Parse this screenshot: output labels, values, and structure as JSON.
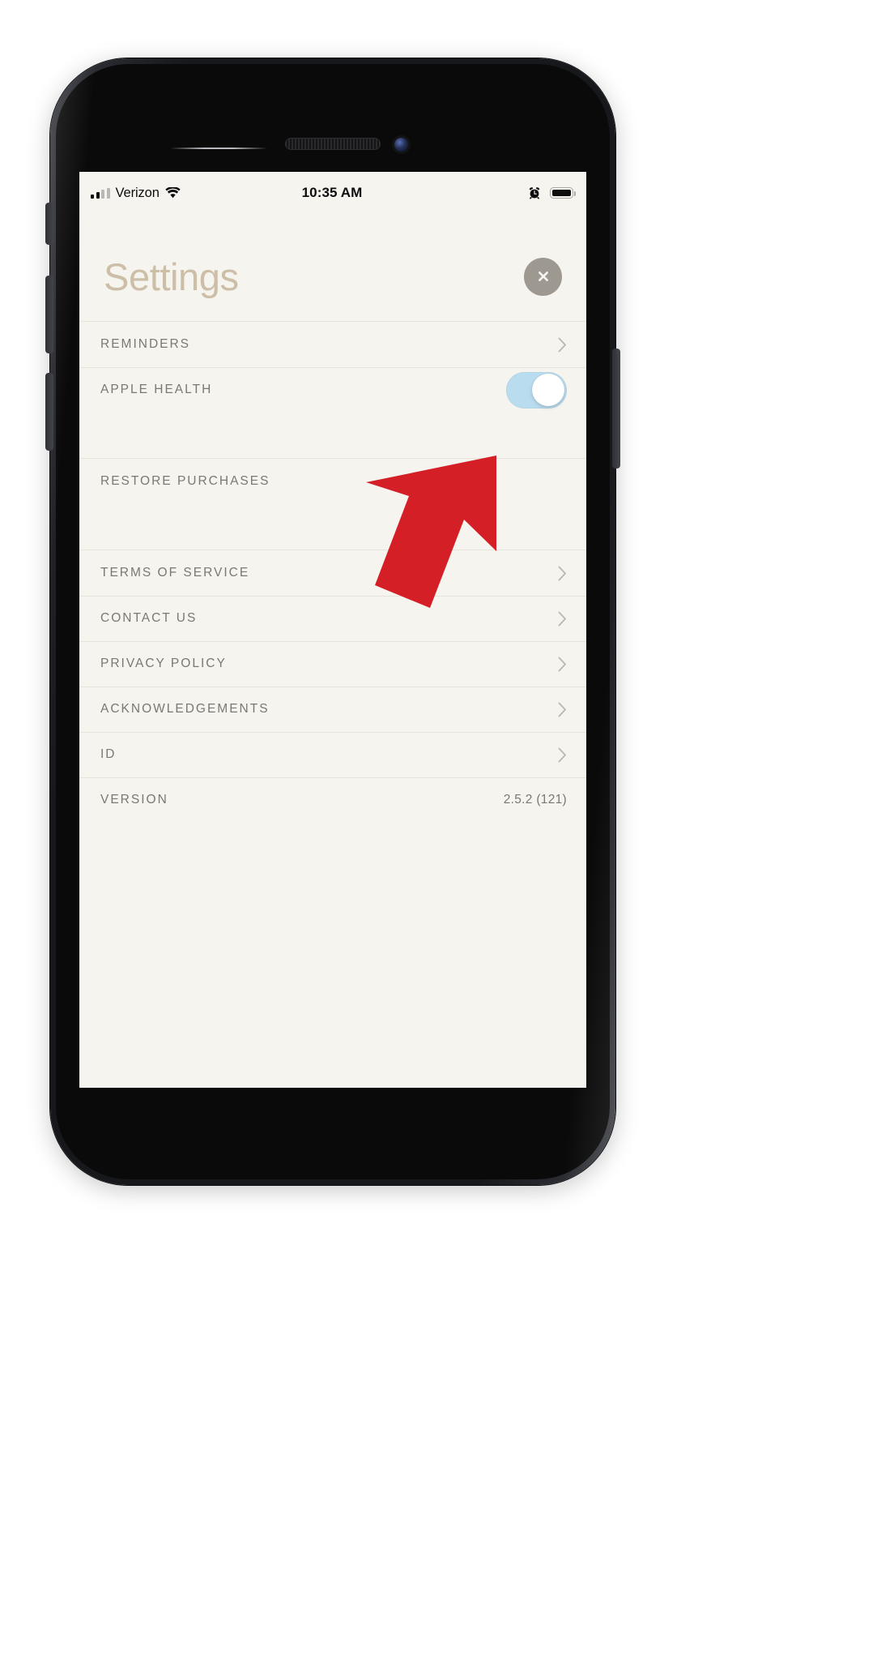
{
  "device": {
    "name": "iphone",
    "frame_color": "#1a1b1f"
  },
  "status_bar": {
    "carrier": "Verizon",
    "signal_icon": "signal-bars-icon",
    "wifi_icon": "wifi-icon",
    "time": "10:35 AM",
    "alarm_icon": "alarm-clock-icon",
    "battery_icon": "battery-full-icon",
    "battery_level_percent": 100
  },
  "header": {
    "title": "Settings",
    "title_color": "#cdbfa7",
    "close_icon": "close-x-icon",
    "close_label": "Close"
  },
  "screen": {
    "background": "#f6f4ef",
    "separator_color": "#e7e4dc",
    "label_color": "#7b7871"
  },
  "groups": [
    {
      "id": "group-1",
      "rows": [
        {
          "label": "REMINDERS",
          "accessory": "chevron",
          "icon": "chevron-right-icon"
        },
        {
          "label": "APPLE HEALTH",
          "accessory": "toggle",
          "icon": "toggle-switch-icon",
          "toggle_on": true,
          "toggle_color": "#b9dcee"
        }
      ]
    },
    {
      "id": "group-2",
      "rows": [
        {
          "label": "RESTORE PURCHASES",
          "accessory": "none",
          "icon": ""
        }
      ]
    },
    {
      "id": "group-3",
      "rows": [
        {
          "label": "TERMS OF SERVICE",
          "accessory": "chevron",
          "icon": "chevron-right-icon"
        },
        {
          "label": "CONTACT US",
          "accessory": "chevron",
          "icon": "chevron-right-icon"
        },
        {
          "label": "PRIVACY POLICY",
          "accessory": "chevron",
          "icon": "chevron-right-icon"
        },
        {
          "label": "ACKNOWLEDGEMENTS",
          "accessory": "chevron",
          "icon": "chevron-right-icon"
        },
        {
          "label": "ID",
          "accessory": "chevron",
          "icon": "chevron-right-icon"
        },
        {
          "label": "VERSION",
          "accessory": "value",
          "icon": "",
          "value": "2.5.2 (121)"
        }
      ]
    }
  ],
  "annotation": {
    "type": "arrow",
    "color": "#d51f26",
    "points_to": "APPLE HEALTH toggle",
    "direction": "up-right"
  }
}
